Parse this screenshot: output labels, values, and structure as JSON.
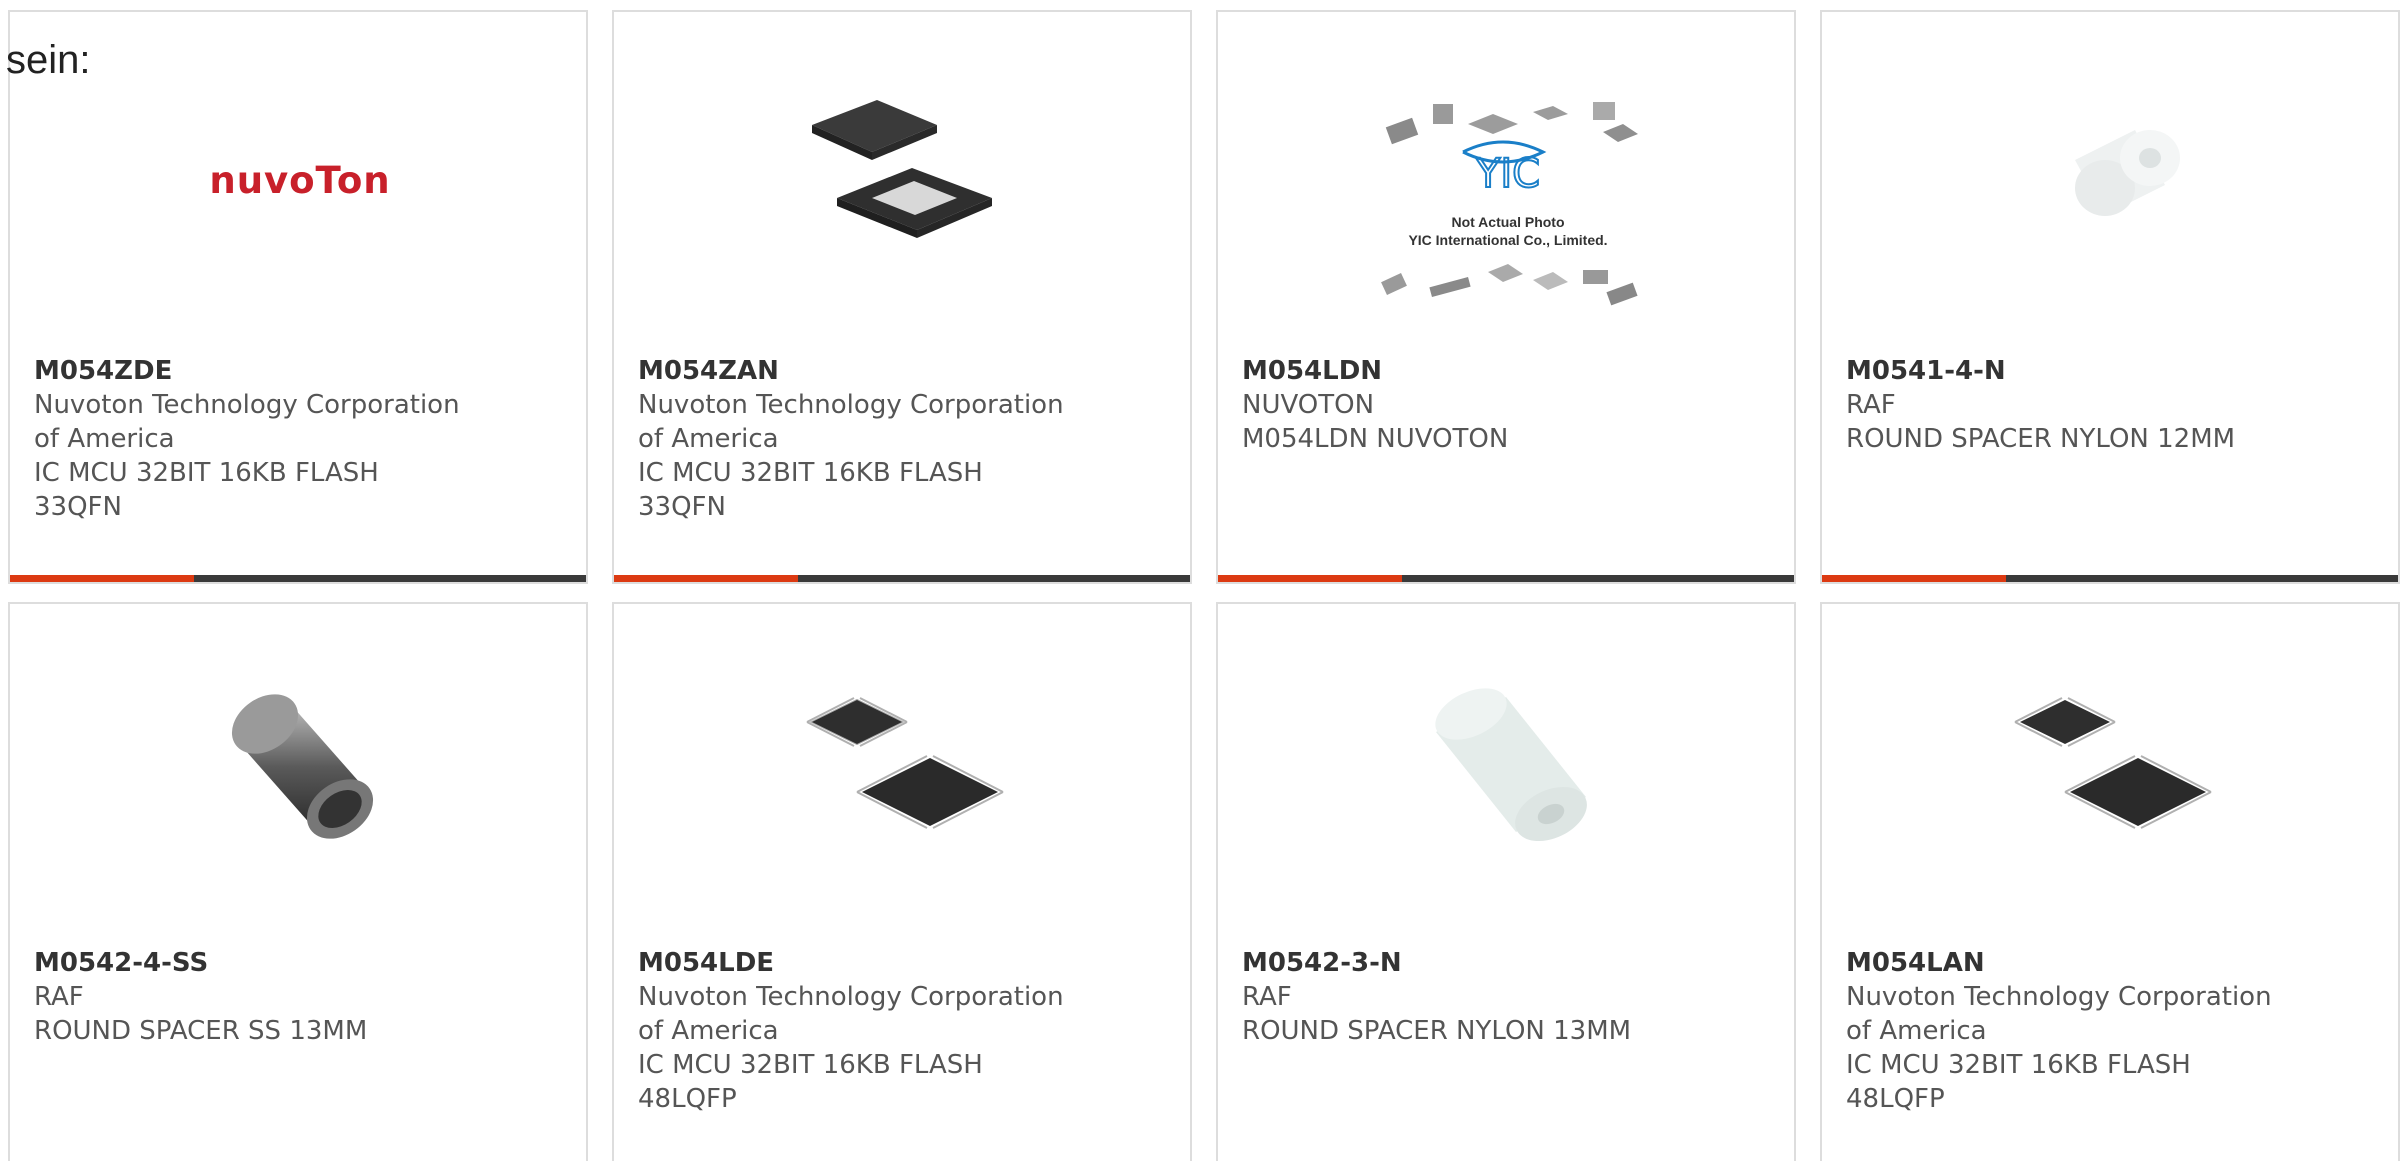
{
  "intro_text": "sein:",
  "colors": {
    "accent": "#dc3a12",
    "bar": "#3a3a3a",
    "card_border": "#dddddd"
  },
  "products": [
    {
      "part": "M054ZDE",
      "manufacturer": "Nuvoton Technology Corporation of America",
      "description": "IC MCU 32BIT 16KB FLASH 33QFN",
      "image": "nuvoton-logo",
      "logo_text": "nuvoTon"
    },
    {
      "part": "M054ZAN",
      "manufacturer": "Nuvoton Technology Corporation of America",
      "description": "IC MCU 32BIT 16KB FLASH 33QFN",
      "image": "qfn-chip"
    },
    {
      "part": "M054LDN",
      "manufacturer": "NUVOTON",
      "description": "M054LDN NUVOTON",
      "image": "yic-placeholder",
      "yic_line1": "Not Actual Photo",
      "yic_line2": "YIC International Co., Limited."
    },
    {
      "part": "M0541-4-N",
      "manufacturer": "RAF",
      "description": "ROUND SPACER NYLON 12MM",
      "image": "nylon-spacer"
    },
    {
      "part": "M0542-4-SS",
      "manufacturer": "RAF",
      "description": "ROUND SPACER SS 13MM",
      "image": "steel-spacer"
    },
    {
      "part": "M054LDE",
      "manufacturer": "Nuvoton Technology Corporation of America",
      "description": "IC MCU 32BIT 16KB FLASH 48LQFP",
      "image": "lqfp-chip"
    },
    {
      "part": "M0542-3-N",
      "manufacturer": "RAF",
      "description": "ROUND SPACER NYLON 13MM",
      "image": "nylon-spacer"
    },
    {
      "part": "M054LAN",
      "manufacturer": "Nuvoton Technology Corporation of America",
      "description": "IC MCU 32BIT 16KB FLASH 48LQFP",
      "image": "lqfp-chip"
    }
  ]
}
